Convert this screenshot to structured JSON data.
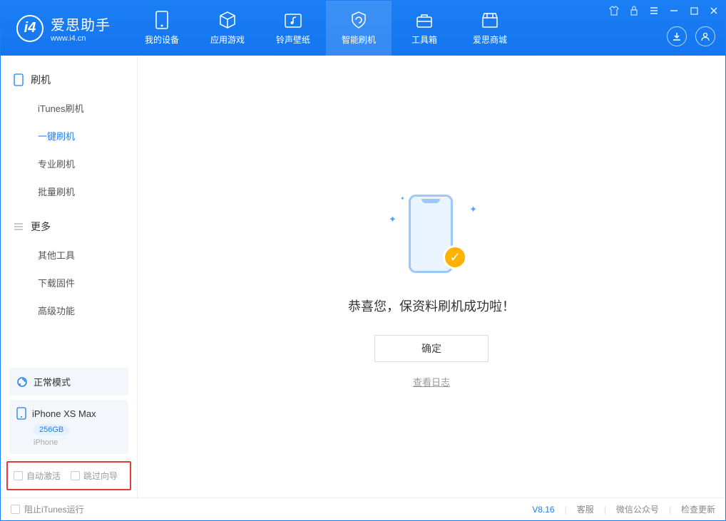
{
  "app": {
    "title": "爱思助手",
    "subtitle": "www.i4.cn"
  },
  "nav": {
    "items": [
      {
        "label": "我的设备"
      },
      {
        "label": "应用游戏"
      },
      {
        "label": "铃声壁纸"
      },
      {
        "label": "智能刷机"
      },
      {
        "label": "工具箱"
      },
      {
        "label": "爱思商城"
      }
    ]
  },
  "sidebar": {
    "group1": "刷机",
    "items1": [
      {
        "label": "iTunes刷机"
      },
      {
        "label": "一键刷机"
      },
      {
        "label": "专业刷机"
      },
      {
        "label": "批量刷机"
      }
    ],
    "group2": "更多",
    "items2": [
      {
        "label": "其他工具"
      },
      {
        "label": "下载固件"
      },
      {
        "label": "高级功能"
      }
    ],
    "mode": "正常模式",
    "device": {
      "name": "iPhone XS Max",
      "capacity": "256GB",
      "type": "iPhone"
    },
    "checkboxes": {
      "auto_activate": "自动激活",
      "skip_guide": "跳过向导"
    }
  },
  "main": {
    "success_text": "恭喜您，保资料刷机成功啦！",
    "ok_button": "确定",
    "view_log": "查看日志"
  },
  "footer": {
    "block_itunes": "阻止iTunes运行",
    "version": "V8.16",
    "links": {
      "service": "客服",
      "wechat": "微信公众号",
      "update": "检查更新"
    }
  }
}
